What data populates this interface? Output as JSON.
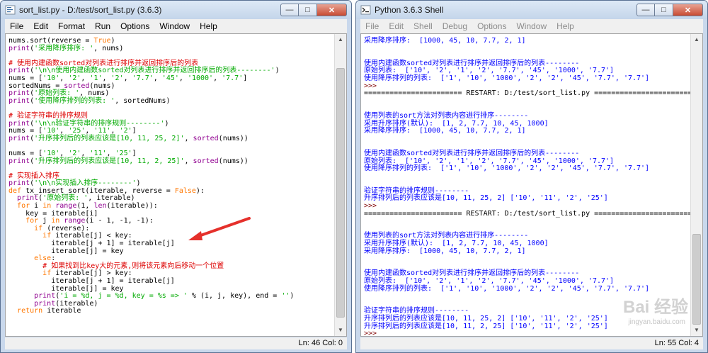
{
  "left_window": {
    "title": "sort_list.py - D:/test/sort_list.py (3.6.3)",
    "menu": [
      "File",
      "Edit",
      "Format",
      "Run",
      "Options",
      "Window",
      "Help"
    ],
    "status": "Ln: 46  Col: 0",
    "code_lines": [
      [
        {
          "t": "nums.sort(reverse = "
        },
        {
          "t": "True",
          "c": "kw"
        },
        {
          "t": ")"
        }
      ],
      [
        {
          "t": "print",
          "c": "bi"
        },
        {
          "t": "("
        },
        {
          "t": "'采用降序排序: '",
          "c": "str"
        },
        {
          "t": ", nums)"
        }
      ],
      [],
      [
        {
          "t": "# 使用内建函数sorted对列表进行排序并返回排序后的列表",
          "c": "cm"
        }
      ],
      [
        {
          "t": "print",
          "c": "bi"
        },
        {
          "t": "("
        },
        {
          "t": "'\\n\\n使用内建函数sorted对列表进行排序并返回排序后的列表--------'",
          "c": "str"
        },
        {
          "t": ")"
        }
      ],
      [
        {
          "t": "nums = ["
        },
        {
          "t": "'10'",
          "c": "str"
        },
        {
          "t": ", "
        },
        {
          "t": "'2'",
          "c": "str"
        },
        {
          "t": ", "
        },
        {
          "t": "'1'",
          "c": "str"
        },
        {
          "t": ", "
        },
        {
          "t": "'2'",
          "c": "str"
        },
        {
          "t": ", "
        },
        {
          "t": "'7.7'",
          "c": "str"
        },
        {
          "t": ", "
        },
        {
          "t": "'45'",
          "c": "str"
        },
        {
          "t": ", "
        },
        {
          "t": "'1000'",
          "c": "str"
        },
        {
          "t": ", "
        },
        {
          "t": "'7.7'",
          "c": "str"
        },
        {
          "t": "]"
        }
      ],
      [
        {
          "t": "sortedNums = "
        },
        {
          "t": "sorted",
          "c": "bi"
        },
        {
          "t": "(nums)"
        }
      ],
      [
        {
          "t": "print",
          "c": "bi"
        },
        {
          "t": "("
        },
        {
          "t": "'原始列表: '",
          "c": "str"
        },
        {
          "t": ", nums)"
        }
      ],
      [
        {
          "t": "print",
          "c": "bi"
        },
        {
          "t": "("
        },
        {
          "t": "'使用降序排列的列表: '",
          "c": "str"
        },
        {
          "t": ", sortedNums)"
        }
      ],
      [],
      [
        {
          "t": "# 验证字符串的排序规则",
          "c": "cm"
        }
      ],
      [
        {
          "t": "print",
          "c": "bi"
        },
        {
          "t": "("
        },
        {
          "t": "'\\n\\n验证字符串的排序规则--------'",
          "c": "str"
        },
        {
          "t": ")"
        }
      ],
      [
        {
          "t": "nums = ["
        },
        {
          "t": "'10'",
          "c": "str"
        },
        {
          "t": ", "
        },
        {
          "t": "'25'",
          "c": "str"
        },
        {
          "t": ", "
        },
        {
          "t": "'11'",
          "c": "str"
        },
        {
          "t": ", "
        },
        {
          "t": "'2'",
          "c": "str"
        },
        {
          "t": "]"
        }
      ],
      [
        {
          "t": "print",
          "c": "bi"
        },
        {
          "t": "("
        },
        {
          "t": "'升序排列后的列表应该是[10, 11, 25, 2]'",
          "c": "str"
        },
        {
          "t": ", "
        },
        {
          "t": "sorted",
          "c": "bi"
        },
        {
          "t": "(nums))"
        }
      ],
      [],
      [
        {
          "t": "nums = ["
        },
        {
          "t": "'10'",
          "c": "str"
        },
        {
          "t": ", "
        },
        {
          "t": "'2'",
          "c": "str"
        },
        {
          "t": ", "
        },
        {
          "t": "'11'",
          "c": "str"
        },
        {
          "t": ", "
        },
        {
          "t": "'25'",
          "c": "str"
        },
        {
          "t": "]"
        }
      ],
      [
        {
          "t": "print",
          "c": "bi"
        },
        {
          "t": "("
        },
        {
          "t": "'升序排列后的列表应该是[10, 11, 2, 25]'",
          "c": "str"
        },
        {
          "t": ", "
        },
        {
          "t": "sorted",
          "c": "bi"
        },
        {
          "t": "(nums))"
        }
      ],
      [],
      [
        {
          "t": "# 实现插入排序",
          "c": "cm"
        }
      ],
      [
        {
          "t": "print",
          "c": "bi"
        },
        {
          "t": "("
        },
        {
          "t": "'\\n\\n实现插入排序--------'",
          "c": "str"
        },
        {
          "t": ")"
        }
      ],
      [
        {
          "t": "def ",
          "c": "kw"
        },
        {
          "t": "tx_insert_sort(iterable, reverse = "
        },
        {
          "t": "False",
          "c": "kw"
        },
        {
          "t": "):"
        }
      ],
      [
        {
          "t": "  "
        },
        {
          "t": "print",
          "c": "bi"
        },
        {
          "t": "("
        },
        {
          "t": "'原始列表: '",
          "c": "str"
        },
        {
          "t": ", iterable)"
        }
      ],
      [
        {
          "t": "  "
        },
        {
          "t": "for ",
          "c": "kw"
        },
        {
          "t": "i "
        },
        {
          "t": "in ",
          "c": "kw"
        },
        {
          "t": "range",
          "c": "bi"
        },
        {
          "t": "(1, "
        },
        {
          "t": "len",
          "c": "bi"
        },
        {
          "t": "(iterable)):"
        }
      ],
      [
        {
          "t": "    key = iterable[i]"
        }
      ],
      [
        {
          "t": "    "
        },
        {
          "t": "for ",
          "c": "kw"
        },
        {
          "t": "j "
        },
        {
          "t": "in ",
          "c": "kw"
        },
        {
          "t": "range",
          "c": "bi"
        },
        {
          "t": "(i - 1, -1, -1):"
        }
      ],
      [
        {
          "t": "      "
        },
        {
          "t": "if ",
          "c": "kw"
        },
        {
          "t": "(reverse):"
        }
      ],
      [
        {
          "t": "        "
        },
        {
          "t": "if ",
          "c": "kw"
        },
        {
          "t": "iterable[j] < key:"
        }
      ],
      [
        {
          "t": "          iterable[j + 1] = iterable[j]"
        }
      ],
      [
        {
          "t": "          iterable[j] = key"
        }
      ],
      [
        {
          "t": "      "
        },
        {
          "t": "else",
          "c": "kw"
        },
        {
          "t": ":"
        }
      ],
      [
        {
          "t": "        "
        },
        {
          "t": "# 如果找到比key大的元素,则将该元素向后移动一个位置",
          "c": "cm"
        }
      ],
      [
        {
          "t": "        "
        },
        {
          "t": "if ",
          "c": "kw"
        },
        {
          "t": "iterable[j] > key:"
        }
      ],
      [
        {
          "t": "          iterable[j + 1] = iterable[j]"
        }
      ],
      [
        {
          "t": "          iterable[j] = key"
        }
      ],
      [
        {
          "t": "      "
        },
        {
          "t": "print",
          "c": "bi"
        },
        {
          "t": "("
        },
        {
          "t": "'i = %d, j = %d, key = %s => '",
          "c": "str"
        },
        {
          "t": " % (i, j, key), end = "
        },
        {
          "t": "''",
          "c": "str"
        },
        {
          "t": ")"
        }
      ],
      [
        {
          "t": "      "
        },
        {
          "t": "print",
          "c": "bi"
        },
        {
          "t": "(iterable)"
        }
      ],
      [
        {
          "t": "  "
        },
        {
          "t": "return ",
          "c": "kw"
        },
        {
          "t": "iterable"
        }
      ]
    ]
  },
  "right_window": {
    "title": "Python 3.6.3 Shell",
    "menu": [
      "File",
      "Edit",
      "Shell",
      "Debug",
      "Options",
      "Window",
      "Help"
    ],
    "status": "Ln: 55  Col: 4",
    "shell_lines": [
      [
        {
          "t": "采用降序排序:  [1000, 45, 10, 7.7, 2, 1]",
          "c": "out"
        }
      ],
      [],
      [],
      [
        {
          "t": "使用内建函数sorted对列表进行排序并返回排序后的列表--------",
          "c": "out"
        }
      ],
      [
        {
          "t": "原始列表:  ['10', '2', '1', '2', '7.7', '45', '1000', '7.7']",
          "c": "out"
        }
      ],
      [
        {
          "t": "使用降序排列的列表:  ['1', '10', '1000', '2', '2', '45', '7.7', '7.7']",
          "c": "out"
        }
      ],
      [
        {
          "t": ">>> ",
          "c": "prompt"
        }
      ],
      [
        {
          "t": "======================= RESTART: D:/test/sort_list.py ======================="
        }
      ],
      [],
      [],
      [
        {
          "t": "使用列表的sort方法对列表内容进行排序--------",
          "c": "out"
        }
      ],
      [
        {
          "t": "采用升序排序(默认):  [1, 2, 7.7, 10, 45, 1000]",
          "c": "out"
        }
      ],
      [
        {
          "t": "采用降序排序:  [1000, 45, 10, 7.7, 2, 1]",
          "c": "out"
        }
      ],
      [],
      [],
      [
        {
          "t": "使用内建函数sorted对列表进行排序并返回排序后的列表--------",
          "c": "out"
        }
      ],
      [
        {
          "t": "原始列表:  ['10', '2', '1', '2', '7.7', '45', '1000', '7.7']",
          "c": "out"
        }
      ],
      [
        {
          "t": "使用降序排列的列表:  ['1', '10', '1000', '2', '2', '45', '7.7', '7.7']",
          "c": "out"
        }
      ],
      [],
      [],
      [
        {
          "t": "验证字符串的排序规则--------",
          "c": "out"
        }
      ],
      [
        {
          "t": "升序排列后的列表应该是[10, 11, 25, 2] ['10', '11', '2', '25']",
          "c": "out"
        }
      ],
      [
        {
          "t": ">>> ",
          "c": "prompt"
        }
      ],
      [
        {
          "t": "======================= RESTART: D:/test/sort_list.py ======================="
        }
      ],
      [],
      [],
      [
        {
          "t": "使用列表的sort方法对列表内容进行排序--------",
          "c": "out"
        }
      ],
      [
        {
          "t": "采用升序排序(默认):  [1, 2, 7.7, 10, 45, 1000]",
          "c": "out"
        }
      ],
      [
        {
          "t": "采用降序排序:  [1000, 45, 10, 7.7, 2, 1]",
          "c": "out"
        }
      ],
      [],
      [],
      [
        {
          "t": "使用内建函数sorted对列表进行排序并返回排序后的列表--------",
          "c": "out"
        }
      ],
      [
        {
          "t": "原始列表:  ['10', '2', '1', '2', '7.7', '45', '1000', '7.7']",
          "c": "out"
        }
      ],
      [
        {
          "t": "使用降序排列的列表:  ['1', '10', '1000', '2', '2', '45', '7.7', '7.7']",
          "c": "out"
        }
      ],
      [],
      [],
      [
        {
          "t": "验证字符串的排序规则--------",
          "c": "out"
        }
      ],
      [
        {
          "t": "升序排列后的列表应该是[10, 11, 25, 2] ['10', '11', '2', '25']",
          "c": "out"
        }
      ],
      [
        {
          "t": "升序排列后的列表应该是[10, 11, 2, 25] ['10', '11', '2', '25']",
          "c": "out"
        }
      ],
      [
        {
          "t": ">>> ",
          "c": "prompt"
        }
      ]
    ]
  },
  "watermark": {
    "text": "Bai 经验",
    "sub": "jingyan.baidu.com"
  }
}
